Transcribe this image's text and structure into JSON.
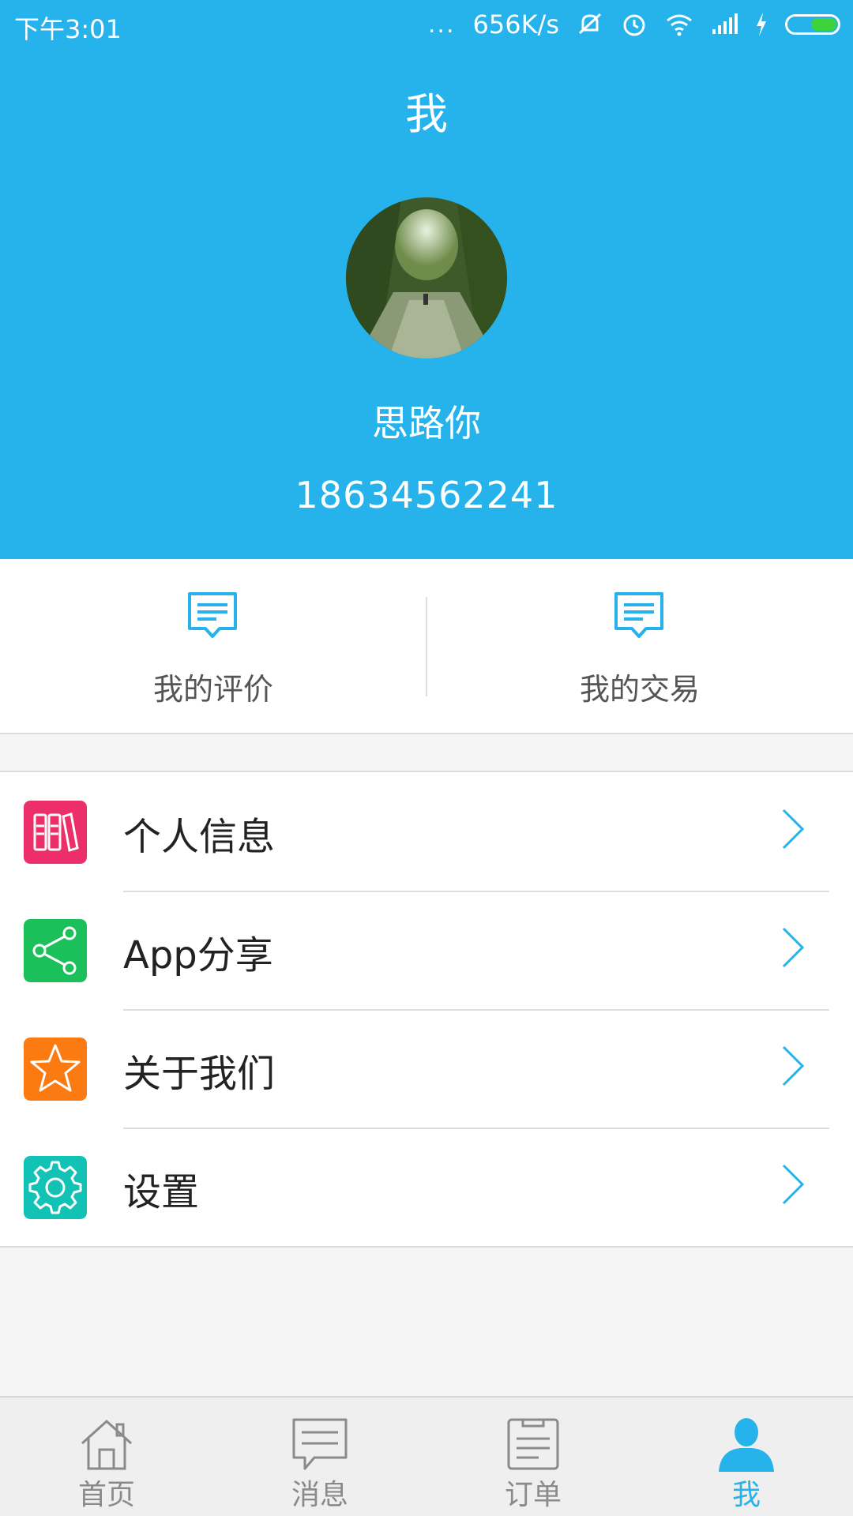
{
  "status_bar": {
    "time": "下午3:01",
    "dots": "...",
    "speed": "656K/s"
  },
  "header": {
    "title": "我",
    "nickname": "思路你",
    "phone": "18634562241"
  },
  "quick_actions": [
    {
      "label": "我的评价",
      "icon": "comment-icon"
    },
    {
      "label": "我的交易",
      "icon": "comment-icon"
    }
  ],
  "menu": [
    {
      "label": "个人信息",
      "icon": "books-icon",
      "color": "#ec2f6b"
    },
    {
      "label": "App分享",
      "icon": "share-icon",
      "color": "#1cc05b"
    },
    {
      "label": "关于我们",
      "icon": "star-icon",
      "color": "#fb7a11"
    },
    {
      "label": "设置",
      "icon": "gear-icon",
      "color": "#12c3b5"
    }
  ],
  "tabbar": [
    {
      "label": "首页",
      "icon": "home-icon",
      "active": false
    },
    {
      "label": "消息",
      "icon": "message-icon",
      "active": false
    },
    {
      "label": "订单",
      "icon": "order-icon",
      "active": false
    },
    {
      "label": "我",
      "icon": "user-icon",
      "active": true
    }
  ],
  "colors": {
    "primary": "#26b2ea",
    "inactive": "#8a8a8a"
  }
}
